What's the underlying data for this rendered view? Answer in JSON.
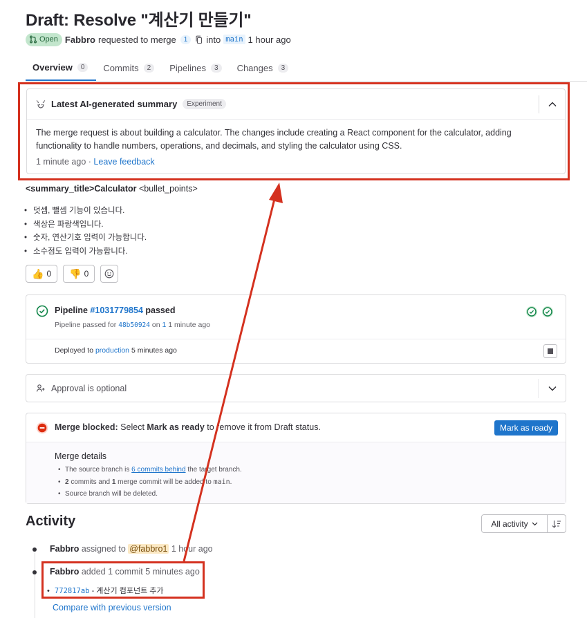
{
  "header": {
    "title": "Draft: Resolve \"계산기 만들기\"",
    "status_badge": "Open",
    "author": "Fabbro",
    "requested_text": "requested to merge",
    "commit_count": "1",
    "into_text": "into",
    "target_branch": "main",
    "time_ago": "1 hour ago"
  },
  "tabs": [
    {
      "label": "Overview",
      "count": "0"
    },
    {
      "label": "Commits",
      "count": "2"
    },
    {
      "label": "Pipelines",
      "count": "3"
    },
    {
      "label": "Changes",
      "count": "3"
    }
  ],
  "ai_summary": {
    "title": "Latest AI-generated summary",
    "badge": "Experiment",
    "body": "The merge request is about building a calculator. The changes include creating a React component for the calculator, adding functionality to handle numbers, operations, and decimals, and styling the calculator using CSS.",
    "time": "1 minute ago",
    "separator": "·",
    "feedback_link": "Leave feedback"
  },
  "description": {
    "summary_tag_open": "<summary_title>",
    "summary_title": "Calculator",
    "bullet_tag": "<bullet_points>",
    "bullets": [
      "덧셈, 뺄셈 기능이 있습니다.",
      "색상은 파랑색입니다.",
      "숫자, 연산기호 입력이 가능합니다.",
      "소수점도 입력이 가능합니다."
    ]
  },
  "reactions": {
    "thumbs_up_count": "0",
    "thumbs_down_count": "0"
  },
  "pipeline": {
    "label": "Pipeline",
    "id": "#1031779854",
    "status": "passed",
    "sub_prefix": "Pipeline passed for",
    "sha": "48b50924",
    "sub_on": "on",
    "sub_ref": "1",
    "sub_time": "1 minute ago",
    "deploy_prefix": "Deployed to",
    "environment": "production",
    "deploy_time": "5 minutes ago"
  },
  "approval": {
    "text": "Approval is optional"
  },
  "merge": {
    "blocked_label": "Merge blocked:",
    "text_1": "Select",
    "mark_bold": "Mark as ready",
    "text_2": "to remove it from Draft status.",
    "ready_button": "Mark as ready",
    "details_title": "Merge details",
    "detail_1_pre": "The source branch is",
    "detail_1_link": "6 commits behind",
    "detail_1_post": "the target branch.",
    "detail_2_n1": "2",
    "detail_2_mid": "commits and",
    "detail_2_n2": "1",
    "detail_2_post": "merge commit will be added to",
    "detail_2_branch": "main",
    "detail_2_end": ".",
    "detail_3": "Source branch will be deleted."
  },
  "activity": {
    "title": "Activity",
    "filter_label": "All activity",
    "items": [
      {
        "author": "Fabbro",
        "action": "assigned to",
        "mention": "@fabbro1",
        "time": "1 hour ago"
      },
      {
        "author": "Fabbro",
        "action": "added 1 commit",
        "time": "5 minutes ago"
      }
    ],
    "commit_sha": "772817ab",
    "commit_sep": "-",
    "commit_msg": "계산기 컴포넌트 추가",
    "compare_link": "Compare with previous version"
  },
  "colors": {
    "annotation": "#d4311f",
    "link": "#1f75cb",
    "success": "#108548",
    "danger": "#dd2b0e"
  }
}
